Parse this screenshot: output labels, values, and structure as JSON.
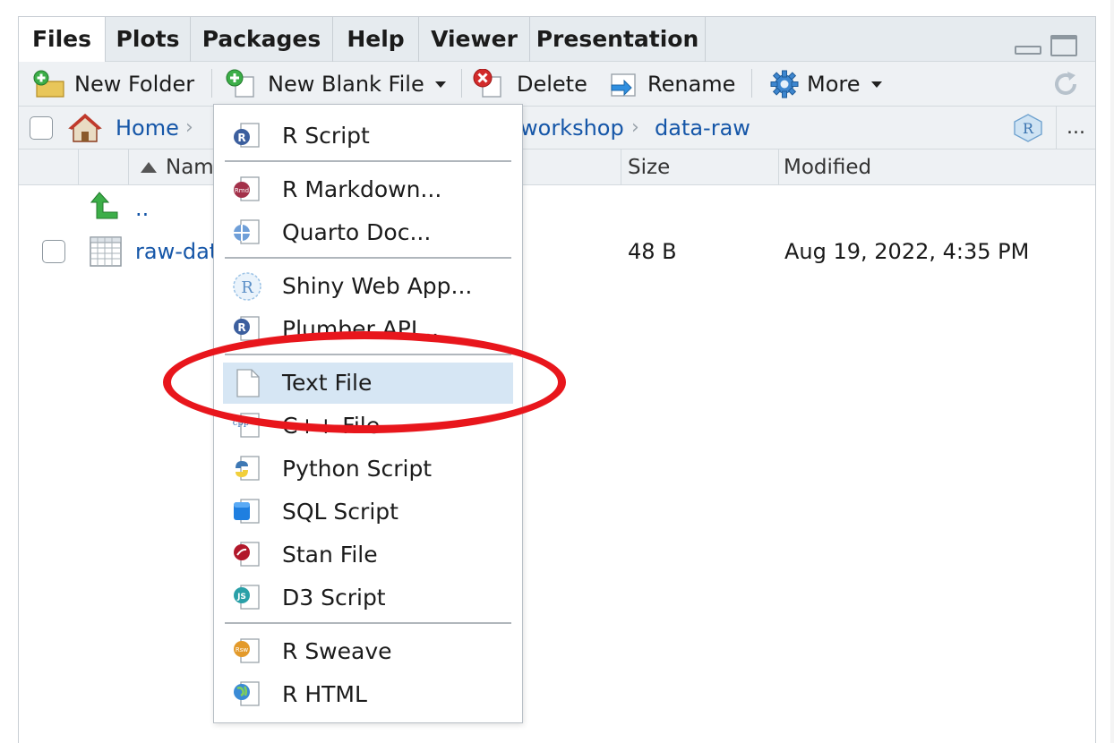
{
  "tabs": [
    "Files",
    "Plots",
    "Packages",
    "Help",
    "Viewer",
    "Presentation"
  ],
  "active_tab": "Files",
  "toolbar": {
    "new_folder": "New Folder",
    "new_blank_file": "New Blank File",
    "delete": "Delete",
    "rename": "Rename",
    "more": "More"
  },
  "breadcrumb": {
    "home": "Home",
    "visible_a": "workshop",
    "visible_b": "data-raw",
    "overflow": "..."
  },
  "columns": {
    "name": "Name",
    "size": "Size",
    "modified": "Modified"
  },
  "rows": [
    {
      "name": "..",
      "size": "",
      "modified": ""
    },
    {
      "name": "raw-data",
      "size": "48 B",
      "modified": "Aug 19, 2022, 4:35 PM"
    }
  ],
  "menu": {
    "items": [
      {
        "label": "R Script",
        "icon": "r-script-icon"
      },
      {
        "label": "R Markdown...",
        "icon": "r-markdown-icon"
      },
      {
        "label": "Quarto Doc...",
        "icon": "quarto-icon"
      },
      {
        "label": "Shiny Web App...",
        "icon": "shiny-icon"
      },
      {
        "label": "Plumber API...",
        "icon": "plumber-icon"
      },
      {
        "label": "Text File",
        "icon": "text-file-icon"
      },
      {
        "label": "C++ File",
        "icon": "cpp-icon"
      },
      {
        "label": "Python Script",
        "icon": "python-icon"
      },
      {
        "label": "SQL Script",
        "icon": "sql-icon"
      },
      {
        "label": "Stan File",
        "icon": "stan-icon"
      },
      {
        "label": "D3 Script",
        "icon": "d3-icon"
      },
      {
        "label": "R Sweave",
        "icon": "sweave-icon"
      },
      {
        "label": "R HTML",
        "icon": "r-html-icon"
      }
    ],
    "highlighted": "Text File",
    "annotation": "red ellipse circling Text File"
  },
  "colors": {
    "tab_bg": "#e6ebef",
    "toolbar_bg": "#eef1f4",
    "link": "#1556a8",
    "highlight": "#d6e6f4",
    "annotation_red": "#e8161c"
  }
}
